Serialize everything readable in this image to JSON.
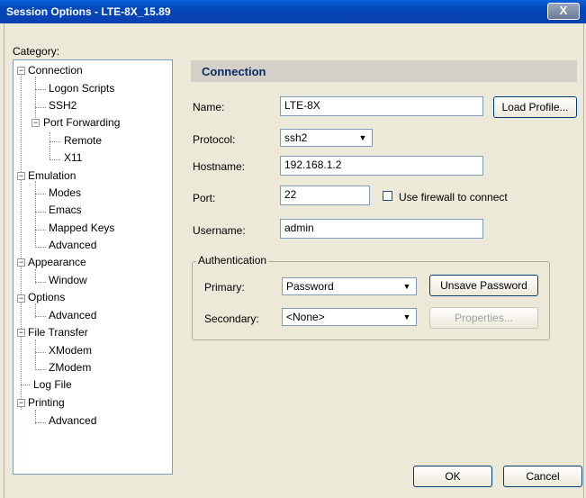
{
  "window": {
    "title": "Session Options - LTE-8X_15.89",
    "close_symbol": "X"
  },
  "category_label": "Category:",
  "tree": [
    {
      "label": "Connection",
      "expander": "−"
    },
    {
      "label": "Logon Scripts"
    },
    {
      "label": "SSH2"
    },
    {
      "label": "Port Forwarding",
      "expander": "−"
    },
    {
      "label": "Remote"
    },
    {
      "label": "X11"
    },
    {
      "label": "Emulation",
      "expander": "−"
    },
    {
      "label": "Modes"
    },
    {
      "label": "Emacs"
    },
    {
      "label": "Mapped Keys"
    },
    {
      "label": "Advanced"
    },
    {
      "label": "Appearance",
      "expander": "−"
    },
    {
      "label": "Window"
    },
    {
      "label": "Options",
      "expander": "−"
    },
    {
      "label": "Advanced"
    },
    {
      "label": "File Transfer",
      "expander": "−"
    },
    {
      "label": "XModem"
    },
    {
      "label": "ZModem"
    },
    {
      "label": "Log File"
    },
    {
      "label": "Printing",
      "expander": "−"
    },
    {
      "label": "Advanced"
    }
  ],
  "section_title": "Connection",
  "form": {
    "name_label": "Name:",
    "name_value": "LTE-8X",
    "load_profile": "Load Profile...",
    "protocol_label": "Protocol:",
    "protocol_value": "ssh2",
    "hostname_label": "Hostname:",
    "hostname_value": "192.168.1.2",
    "port_label": "Port:",
    "port_value": "22",
    "firewall_label": "Use firewall to connect",
    "username_label": "Username:",
    "username_value": "admin"
  },
  "auth": {
    "group_label": "Authentication",
    "primary_label": "Primary:",
    "primary_value": "Password",
    "secondary_label": "Secondary:",
    "secondary_value": "<None>",
    "unsave_password": "Unsave Password",
    "properties": "Properties..."
  },
  "buttons": {
    "ok": "OK",
    "cancel": "Cancel"
  },
  "icons": {
    "dropdown_arrow": "▼"
  }
}
